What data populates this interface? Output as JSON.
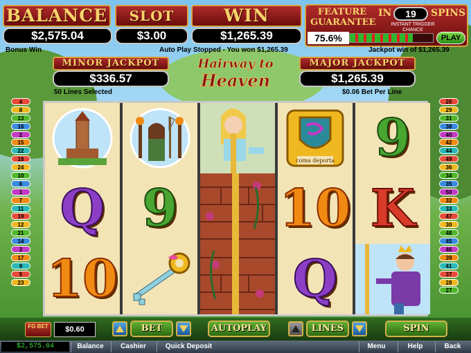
{
  "header": {
    "balance_label": "BALANCE",
    "balance_value": "$2,575.04",
    "slot_bet_label": "SLOT BET",
    "slot_bet_value": "$3.00",
    "win_label": "WIN",
    "win_value": "$1,265.39",
    "feature_label_1": "FEATURE",
    "feature_label_2": "GUARANTEE",
    "feature_in": "IN",
    "feature_spins_count": "19",
    "feature_spins_label": "SPINS",
    "feature_chance_pct": "75.6%",
    "feature_chance_fraction": 0.756,
    "feature_chance_label": "INSTANT TRIGGER CHANCE",
    "play_label": "PLAY"
  },
  "messages": {
    "bonus_win": "Bonus Win",
    "auto_play": "Auto Play Stopped - You won $1,265.39",
    "jackpot_win": "Jackpot win of $1,265.39",
    "lines_selected": "50 Lines Selected",
    "bet_per_line": "$0.06 Bet Per Line"
  },
  "jackpots": {
    "minor_label": "MINOR JACKPOT",
    "minor_value": "$336.57",
    "major_label": "MAJOR JACKPOT",
    "major_value": "$1,265.39"
  },
  "logo": {
    "line1": "Hairway to",
    "line2": "Heaven"
  },
  "left_lines": [
    "4",
    "8",
    "13",
    "16",
    "2",
    "15",
    "22",
    "18",
    "24",
    "10",
    "6",
    "1",
    "7",
    "11",
    "19",
    "12",
    "21",
    "14",
    "3",
    "17",
    "9",
    "5",
    "23"
  ],
  "right_lines": [
    "26",
    "29",
    "31",
    "38",
    "40",
    "42",
    "44",
    "49",
    "36",
    "34",
    "35",
    "50",
    "32",
    "33",
    "47",
    "30",
    "48",
    "45",
    "46",
    "39",
    "41",
    "37",
    "28",
    "27"
  ],
  "reels": [
    [
      "tower",
      "Q",
      "10"
    ],
    [
      "rapunzel-axe",
      "9",
      "key"
    ],
    [
      "rapunzel-tower",
      "wall-roses",
      "wall-roses"
    ],
    [
      "crest",
      "10",
      "Q"
    ],
    [
      "9",
      "K",
      "prince"
    ]
  ],
  "crest_text": "coma deporta",
  "controls": {
    "fg_bet_label": "FG BET",
    "fg_bet_value": "$0.60",
    "bet_label": "BET",
    "autoplay_label": "AUTOPLAY",
    "lines_label": "LINES",
    "spin_label": "SPIN"
  },
  "bottom_bar": {
    "balance_value": "$2,575.04",
    "balance_label": "Balance",
    "cashier": "Cashier",
    "quick_deposit": "Quick Deposit",
    "menu": "Menu",
    "help": "Help",
    "back": "Back"
  },
  "colors": {
    "accent_red": "#8b1212",
    "gold": "#d9a441",
    "play_green": "#3fae2a"
  }
}
